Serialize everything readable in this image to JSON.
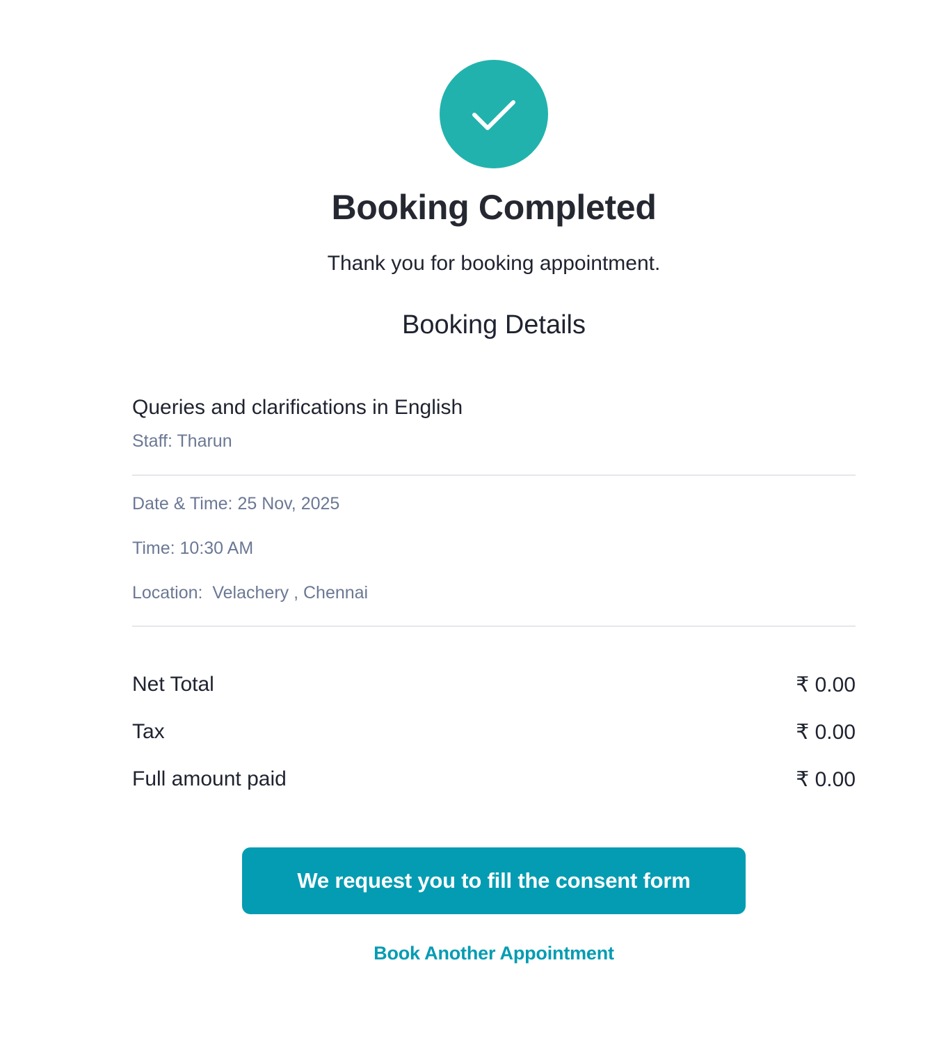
{
  "status": {
    "icon": "checkmark-icon",
    "accent_color": "#22b2ad",
    "title": "Booking Completed",
    "message": "Thank you for booking appointment."
  },
  "details": {
    "heading": "Booking Details",
    "service": "Queries and clarifications in English",
    "staff": "Staff: Tharun",
    "date_time": "Date & Time: 25 Nov, 2025",
    "time": "Time: 10:30 AM",
    "location": "Location:  Velachery , Chennai"
  },
  "totals": [
    {
      "label": "Net Total",
      "value": "₹ 0.00"
    },
    {
      "label": "Tax",
      "value": "₹ 0.00"
    },
    {
      "label": "Full amount paid",
      "value": "₹ 0.00"
    }
  ],
  "actions": {
    "consent_button": "We request you to fill the consent form",
    "book_another": "Book Another Appointment",
    "button_color": "#049cb2"
  }
}
